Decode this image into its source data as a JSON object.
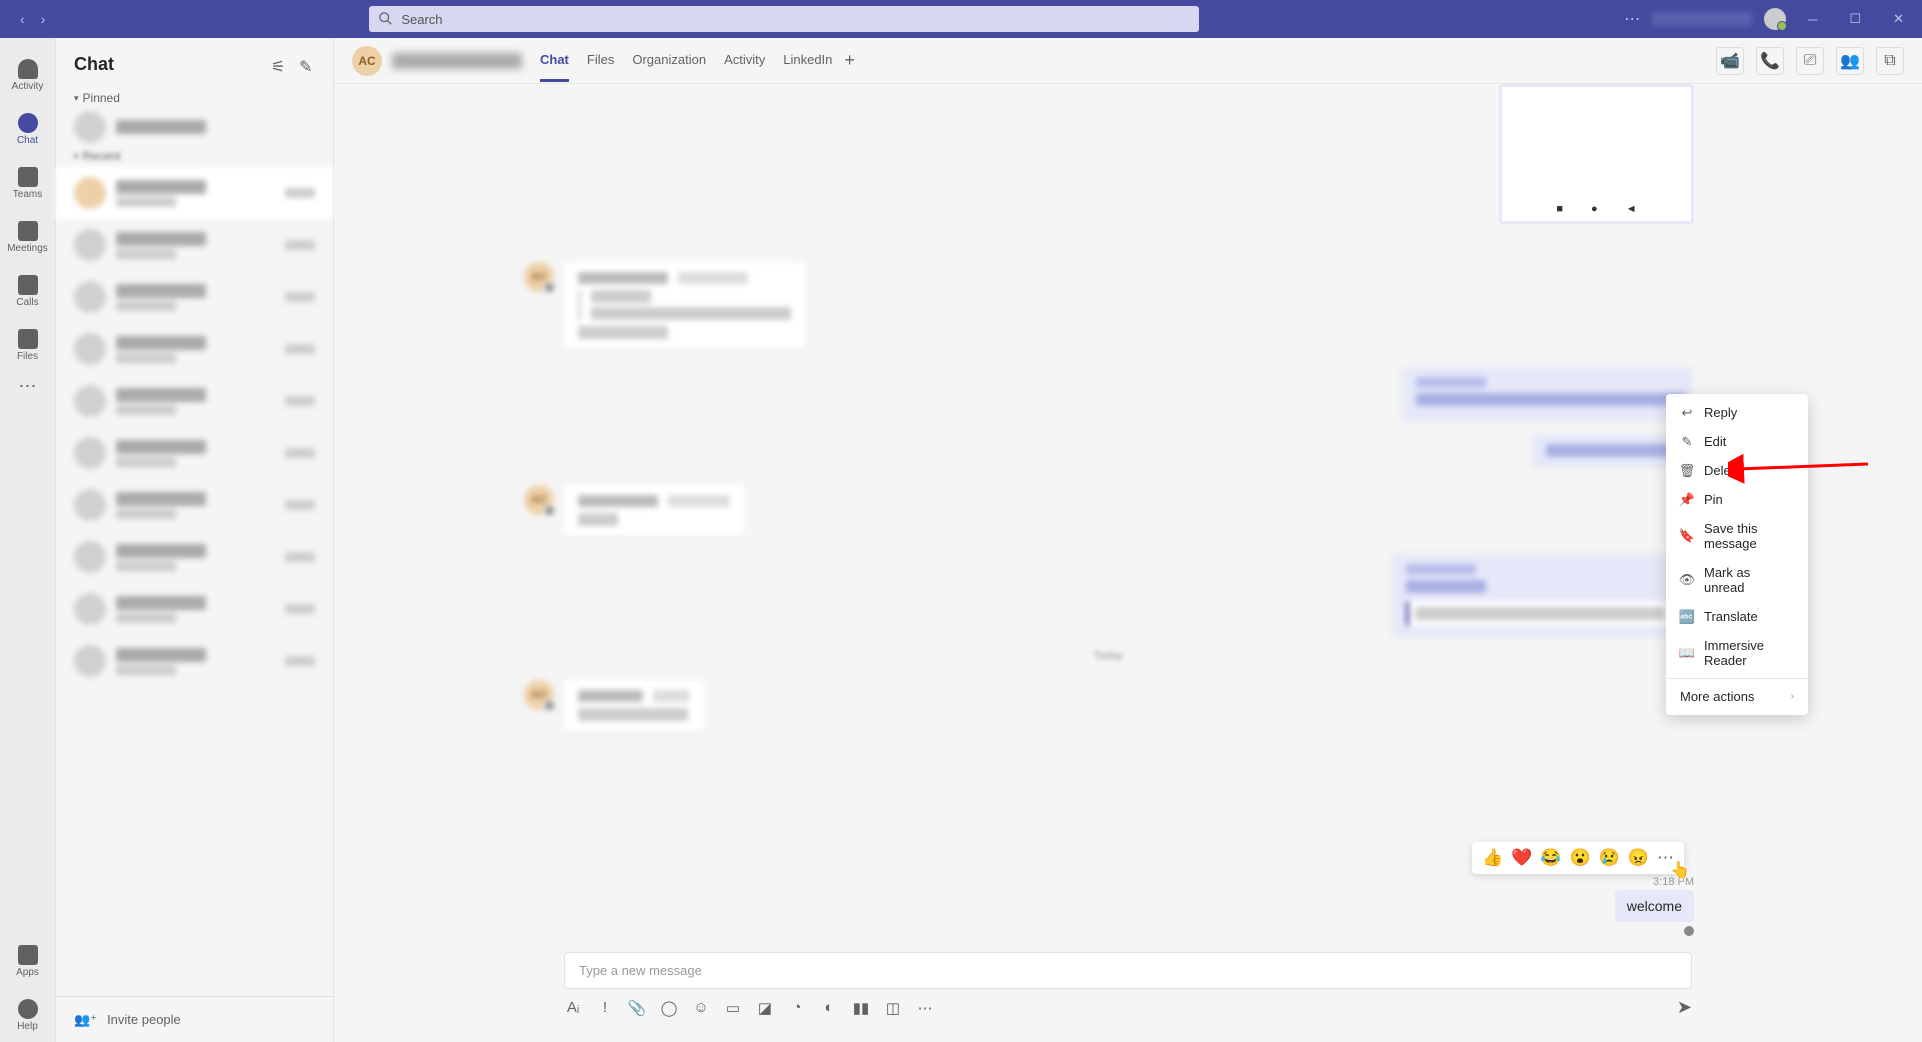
{
  "title_bar": {
    "search_placeholder": "Search"
  },
  "left_rail": {
    "items": [
      {
        "label": "Activity"
      },
      {
        "label": "Chat"
      },
      {
        "label": "Teams"
      },
      {
        "label": "Meetings"
      },
      {
        "label": "Calls"
      },
      {
        "label": "Files"
      }
    ],
    "bottom": [
      {
        "label": "Apps"
      },
      {
        "label": "Help"
      }
    ]
  },
  "chat_list": {
    "title": "Chat",
    "section_pinned": "Pinned",
    "invite_label": "Invite people"
  },
  "chat_header": {
    "avatar": "AC",
    "tabs": [
      "Chat",
      "Files",
      "Organization",
      "Activity",
      "LinkedIn"
    ]
  },
  "messages": {
    "received_avatar": "AC",
    "sent_time": "3:18 PM",
    "sent_text": "welcome"
  },
  "reactions": [
    "👍",
    "❤️",
    "😂",
    "😮",
    "😢",
    "😠"
  ],
  "context_menu": {
    "items": [
      {
        "icon": "↩",
        "label": "Reply"
      },
      {
        "icon": "✎",
        "label": "Edit"
      },
      {
        "icon": "🗑",
        "label": "Delete"
      },
      {
        "icon": "📌",
        "label": "Pin"
      },
      {
        "icon": "🔖",
        "label": "Save this message"
      },
      {
        "icon": "👁",
        "label": "Mark as unread"
      },
      {
        "icon": "🔤",
        "label": "Translate"
      },
      {
        "icon": "📖",
        "label": "Immersive Reader"
      }
    ],
    "more": "More actions"
  },
  "compose": {
    "placeholder": "Type a new message"
  }
}
